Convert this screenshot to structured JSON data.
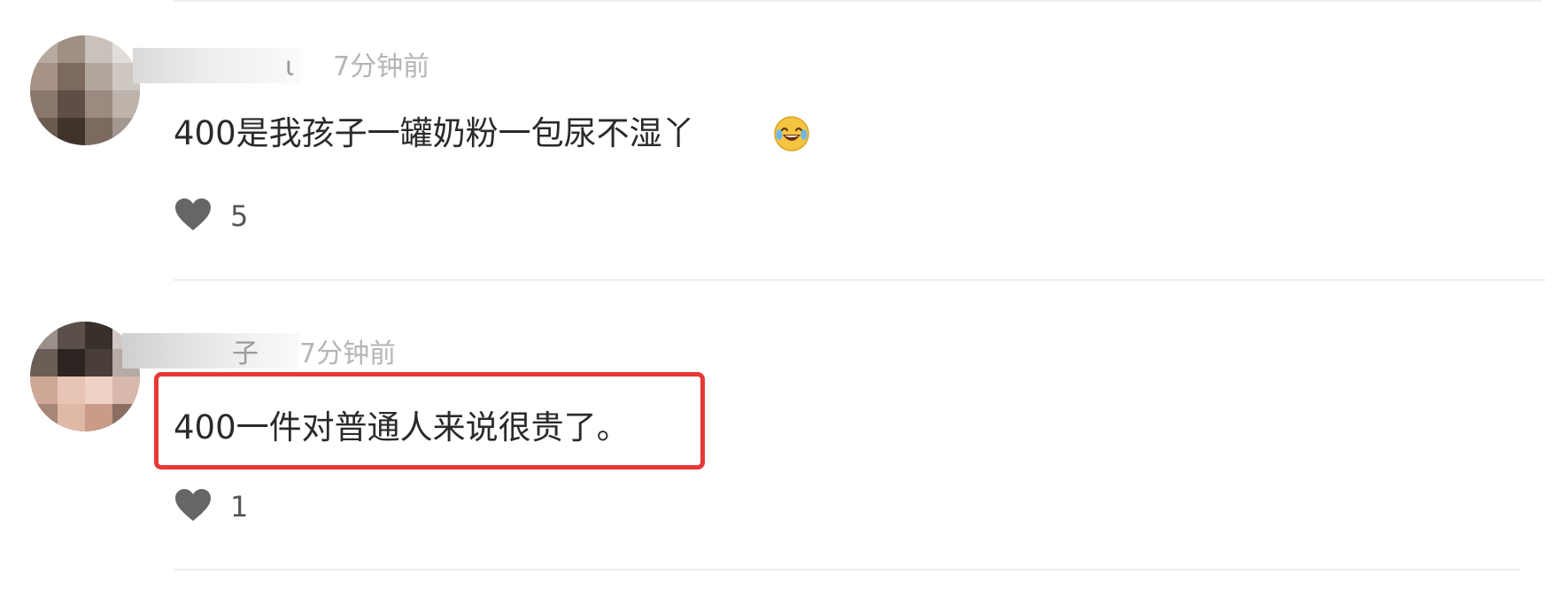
{
  "comments": [
    {
      "username_suffix": "ι",
      "time": "7分钟前",
      "text": "400是我孩子一罐奶粉一包尿不湿丫",
      "emoji": "grinning-sweat-emoji",
      "likes": "5"
    },
    {
      "username_suffix": "子",
      "time": "7分钟前",
      "text": "400一件对普通人来说很贵了。",
      "likes": "1",
      "highlighted": true
    }
  ],
  "colors": {
    "highlight_border": "#e53935",
    "heart": "#666666",
    "timestamp": "#b5b5b5"
  },
  "icons": {
    "like": "heart-icon"
  }
}
